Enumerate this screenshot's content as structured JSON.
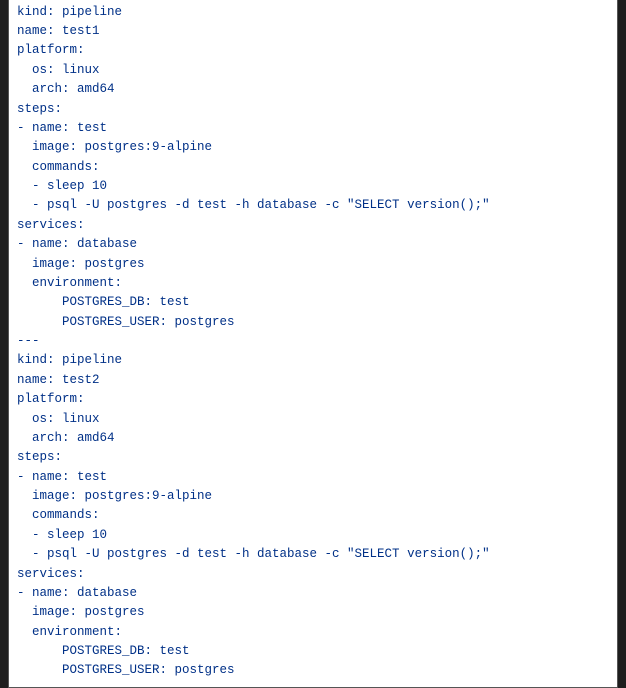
{
  "code": {
    "lines": [
      "---",
      "kind: pipeline",
      "name: test1",
      "platform:",
      "  os: linux",
      "  arch: amd64",
      "steps:",
      "- name: test",
      "  image: postgres:9-alpine",
      "  commands:",
      "  - sleep 10",
      "  - psql -U postgres -d test -h database -c \"SELECT version();\"",
      "services:",
      "- name: database",
      "  image: postgres",
      "  environment:",
      "      POSTGRES_DB: test",
      "      POSTGRES_USER: postgres",
      "---",
      "kind: pipeline",
      "name: test2",
      "platform:",
      "  os: linux",
      "  arch: amd64",
      "steps:",
      "- name: test",
      "  image: postgres:9-alpine",
      "  commands:",
      "  - sleep 10",
      "  - psql -U postgres -d test -h database -c \"SELECT version();\"",
      "services:",
      "- name: database",
      "  image: postgres",
      "  environment:",
      "      POSTGRES_DB: test",
      "      POSTGRES_USER: postgres"
    ]
  }
}
